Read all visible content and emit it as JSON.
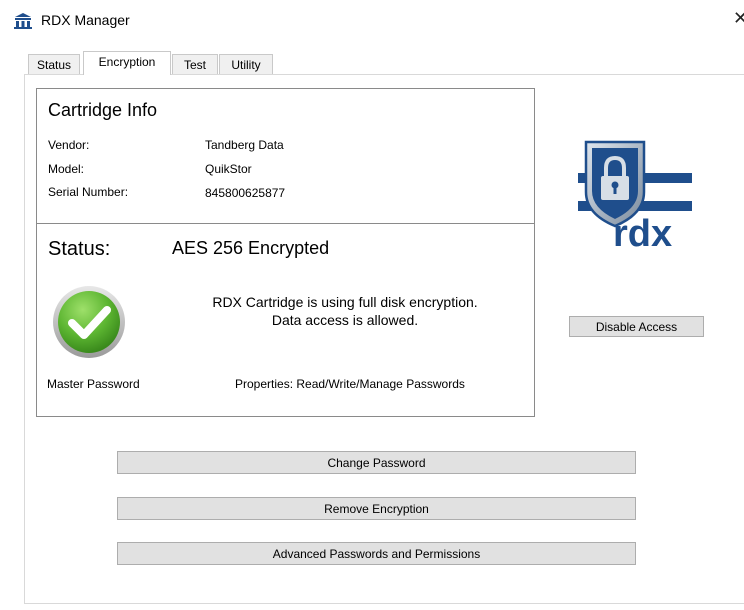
{
  "window": {
    "title": "RDX Manager",
    "close_glyph": "✕"
  },
  "tabs": [
    {
      "label": "Status",
      "active": false
    },
    {
      "label": "Encryption",
      "active": true
    },
    {
      "label": "Test",
      "active": false
    },
    {
      "label": "Utility",
      "active": false
    }
  ],
  "cartridge_info": {
    "heading": "Cartridge Info",
    "vendor_label": "Vendor:",
    "vendor_value": "Tandberg Data",
    "model_label": "Model:",
    "model_value": "QuikStor",
    "serial_label": "Serial Number:",
    "serial_value": "845800625877"
  },
  "status": {
    "label": "Status:",
    "value": "AES 256 Encrypted",
    "message_line1": "RDX Cartridge is using full disk encryption.",
    "message_line2": "Data access is allowed.",
    "password_type": "Master Password",
    "properties": "Properties: Read/Write/Manage Passwords",
    "icon": "green-checkmark-icon"
  },
  "logo": {
    "text": "rdx",
    "icon": "shield-padlock-icon"
  },
  "buttons": {
    "disable_access": "Disable Access",
    "change_password": "Change Password",
    "remove_encryption": "Remove Encryption",
    "advanced": "Advanced Passwords and Permissions"
  },
  "colors": {
    "brand_blue": "#1f4e8c",
    "check_green": "#5cb531"
  }
}
